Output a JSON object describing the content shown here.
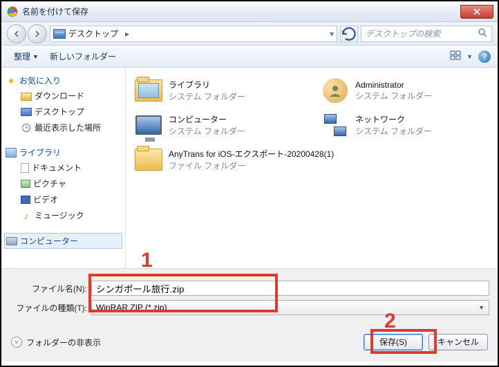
{
  "title": "名前を付けて保存",
  "breadcrumb": {
    "location": "デスクトップ"
  },
  "search": {
    "placeholder": "デスクトップの検索"
  },
  "toolbar": {
    "organize": "整理",
    "new_folder": "新しいフォルダー"
  },
  "sidebar": {
    "favorites": {
      "title": "お気に入り",
      "items": [
        "ダウンロード",
        "デスクトップ",
        "最近表示した場所"
      ]
    },
    "libraries": {
      "title": "ライブラリ",
      "items": [
        "ドキュメント",
        "ピクチャ",
        "ビデオ",
        "ミュージック"
      ]
    },
    "computer": {
      "title": "コンピューター"
    }
  },
  "items": [
    {
      "name": "ライブラリ",
      "sub": "システム フォルダー",
      "icon": "lib-folder"
    },
    {
      "name": "Administrator",
      "sub": "システム フォルダー",
      "icon": "user"
    },
    {
      "name": "コンピューター",
      "sub": "システム フォルダー",
      "icon": "monitor"
    },
    {
      "name": "ネットワーク",
      "sub": "システム フォルダー",
      "icon": "network"
    },
    {
      "name": "AnyTrans for iOS-エクスポート-20200428(1)",
      "sub": "ファイル フォルダー",
      "icon": "folder"
    }
  ],
  "filename_label": "ファイル名(N):",
  "filetype_label": "ファイルの種類(T):",
  "filename_value": "シンガポール旅行.zip",
  "filetype_value": "WinRAR ZIP             (*.zip)",
  "hide_folders": "フォルダーの非表示",
  "save_btn": "保存(S)",
  "cancel_btn": "キャンセル",
  "annotations": {
    "one": "1",
    "two": "2"
  }
}
